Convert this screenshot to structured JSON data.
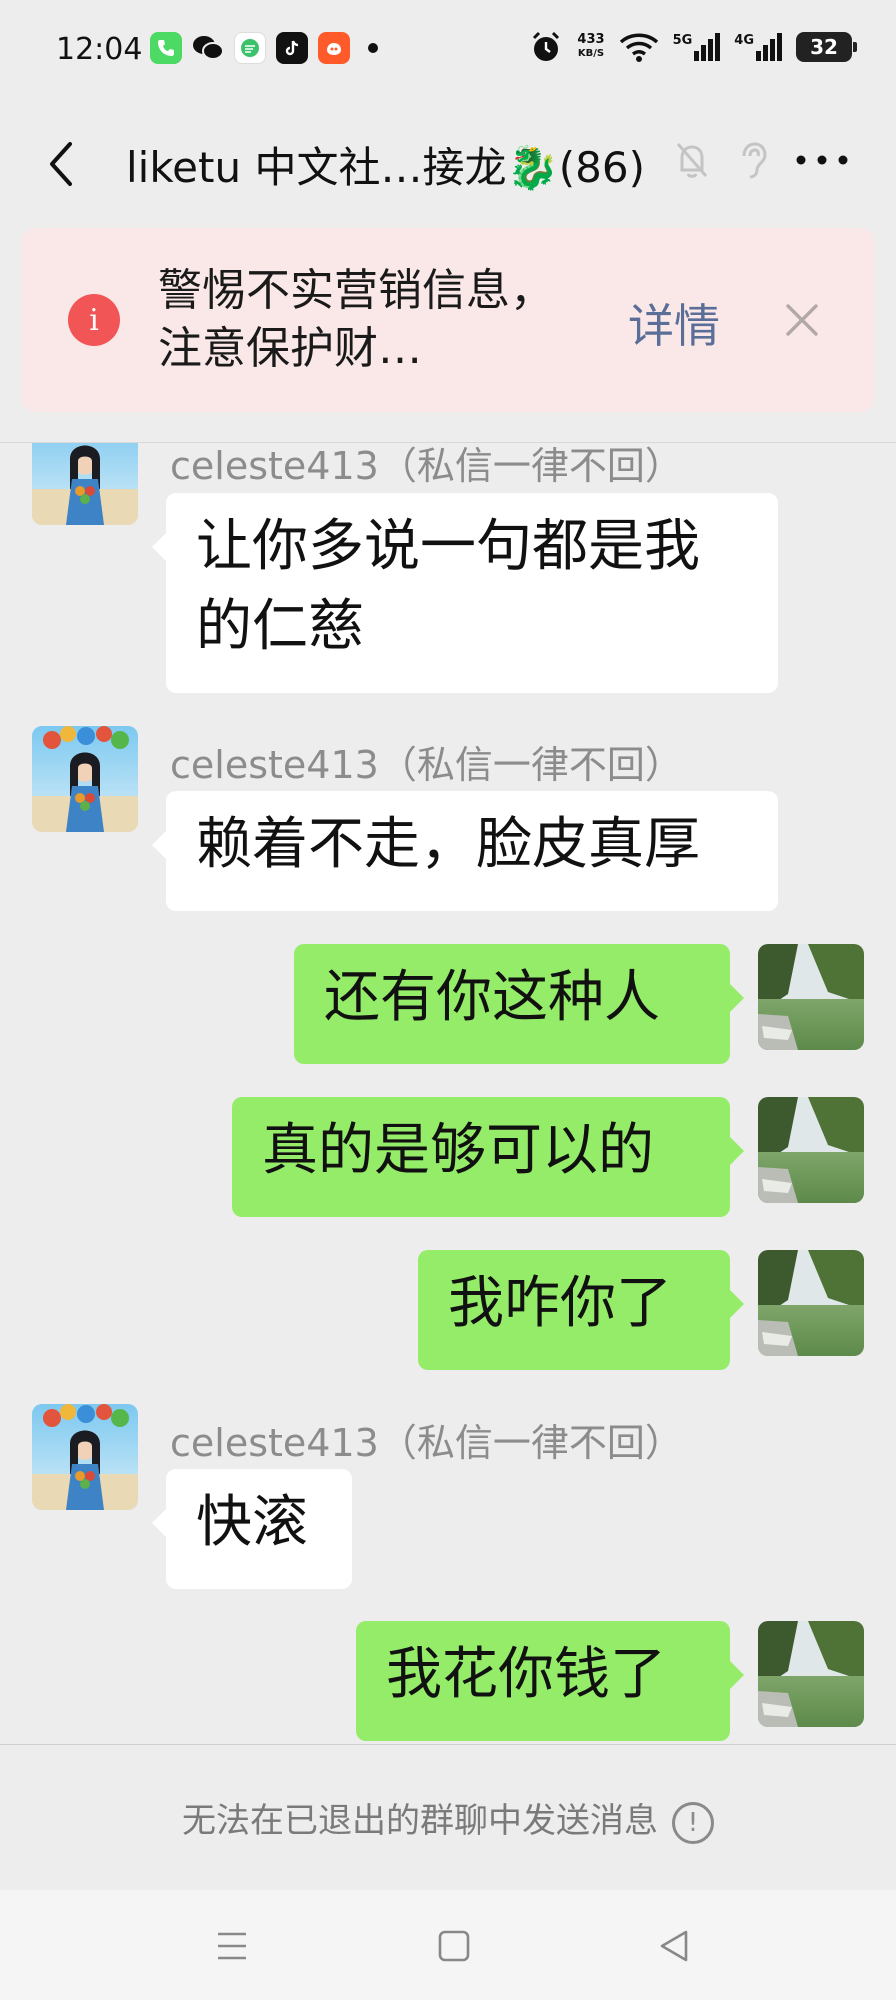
{
  "status_bar": {
    "time": "12:04",
    "net_speed_value": "433",
    "net_speed_unit": "KB/S",
    "signal_1": "5G",
    "signal_2": "4G",
    "battery": "32"
  },
  "header": {
    "title": "liketu 中文社…接龙🐉(86)"
  },
  "warning": {
    "text": "警惕不实营销信息，注意保护财…",
    "detail_label": "详情"
  },
  "messages": [
    {
      "sender": "celeste413（私信一律不回）",
      "text": "让你多说一句都是我的仁慈"
    },
    {
      "sender": "celeste413（私信一律不回）",
      "text": "赖着不走，脸皮真厚"
    },
    {
      "text": "还有你这种人"
    },
    {
      "text": "真的是够可以的"
    },
    {
      "text": "我咋你了"
    },
    {
      "sender": "celeste413（私信一律不回）",
      "text": "快滚"
    },
    {
      "text": "我花你钱了"
    }
  ],
  "notice": {
    "text": "无法在已退出的群聊中发送消息",
    "icon": "!"
  },
  "colors": {
    "bg": "#ededed",
    "bubble_in": "#ffffff",
    "bubble_out": "#95ec69",
    "warning_bg": "#fae8e8",
    "warning_icon": "#f25555",
    "detail_link": "#5a6e97"
  },
  "icons": {
    "back": "chevron-left-icon",
    "mute": "bell-off-icon",
    "ear": "ear-icon",
    "more": "more-horizontal-icon",
    "warn": "info-icon",
    "close": "close-icon",
    "nav_menu": "menu-icon",
    "nav_home": "square-icon",
    "nav_back": "triangle-back-icon"
  }
}
